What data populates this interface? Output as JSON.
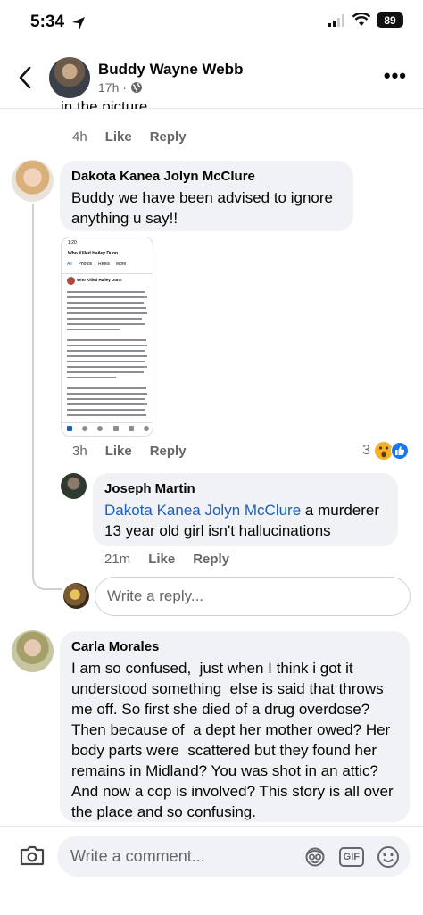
{
  "status_bar": {
    "time": "5:34",
    "battery": "89"
  },
  "header": {
    "name": "Buddy Wayne Webb",
    "time": "17h ·"
  },
  "previous_comment": {
    "cut_text": "in the picture",
    "time": "4h",
    "like": "Like",
    "reply": "Reply"
  },
  "comments": [
    {
      "name": "Dakota Kanea Jolyn McClure",
      "text": "Buddy we have been advised to ignore anything u say!!",
      "time": "3h",
      "like": "Like",
      "reply": "Reply",
      "reaction_count": "3",
      "screenshot": {
        "time": "1:20",
        "page": "Who Killed Hailey Dunn",
        "tabs": [
          "All",
          "Photos",
          "Reels",
          "More"
        ],
        "post_author": "Who Killed Hailey Dunn"
      },
      "replies": [
        {
          "name": "Joseph Martin",
          "mention": "Dakota Kanea Jolyn McClure",
          "text": " a murderer 13 year old girl isn't hallucinations",
          "time": "21m",
          "like": "Like",
          "reply": "Reply"
        }
      ],
      "reply_placeholder": "Write a reply..."
    },
    {
      "name": "Carla Morales",
      "text": "I am so confused,  just when I think i got it understood something  else is said that throws me off. So first she died of a drug overdose? Then because of  a dept her mother owed? Her body parts were  scattered but they found her remains in Midland? You was shot in an attic? And now a cop is involved? This story is all over the place and so confusing."
    }
  ],
  "composer": {
    "placeholder": "Write a comment...",
    "gif_label": "GIF"
  },
  "colors": {
    "link": "#1b5fbf",
    "bubble": "#f0f2f5",
    "secondary_text": "#65676b"
  },
  "icons": [
    "location-arrow-icon",
    "signal-icon",
    "wifi-icon",
    "back-chevron-icon",
    "globe-icon",
    "more-icon",
    "wow-reaction-icon",
    "like-reaction-icon",
    "camera-icon",
    "avatar-sticker-icon",
    "gif-icon",
    "emoji-icon"
  ]
}
